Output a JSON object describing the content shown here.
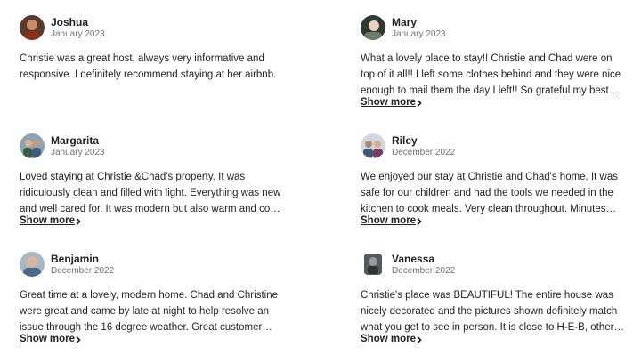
{
  "reviews": [
    {
      "name": "Joshua",
      "date": "January 2023",
      "text": "Christie was a great host, always very informative and responsive. I definitely recommend staying at her airbnb.",
      "show_more": ""
    },
    {
      "name": "Mary",
      "date": "January 2023",
      "text": "What a lovely place to stay!! Christie and Chad were on top of it all!! I left some clothes behind and they were nice enough to mail them the day I left!! So grateful my best friend and I had a wonderful stay.",
      "show_more": "Show more"
    },
    {
      "name": "Margarita",
      "date": "January 2023",
      "text": "Loved staying at Christie &Chad's property. It was ridiculously clean and filled with light. Everything was new and well cared for. It was modern but also warm and comfy due to all the thoughtful touches.",
      "show_more": "Show more"
    },
    {
      "name": "Riley",
      "date": "December 2022",
      "text": "We enjoyed our stay at Christie and Chad's home. It was safe for our children and had the tools we needed in the kitchen to cook meals. Very clean throughout. Minutes away from places to eat and shop.",
      "show_more": "Show more"
    },
    {
      "name": "Benjamin",
      "date": "December 2022",
      "text": "Great time at a lovely, modern home. Chad and Christine were great and came by late at night to help resolve an issue through the 16 degree weather. Great customer service and a very comfortable stay.",
      "show_more": "Show more"
    },
    {
      "name": "Vanessa",
      "date": "December 2022",
      "text": "Christie's place was BEAUTIFUL! The entire house was nicely decorated and the pictures shown definitely match what you get to see in person. It is close to H-E-B, other stores and the highway, very convenient.",
      "show_more": "Show more"
    }
  ]
}
